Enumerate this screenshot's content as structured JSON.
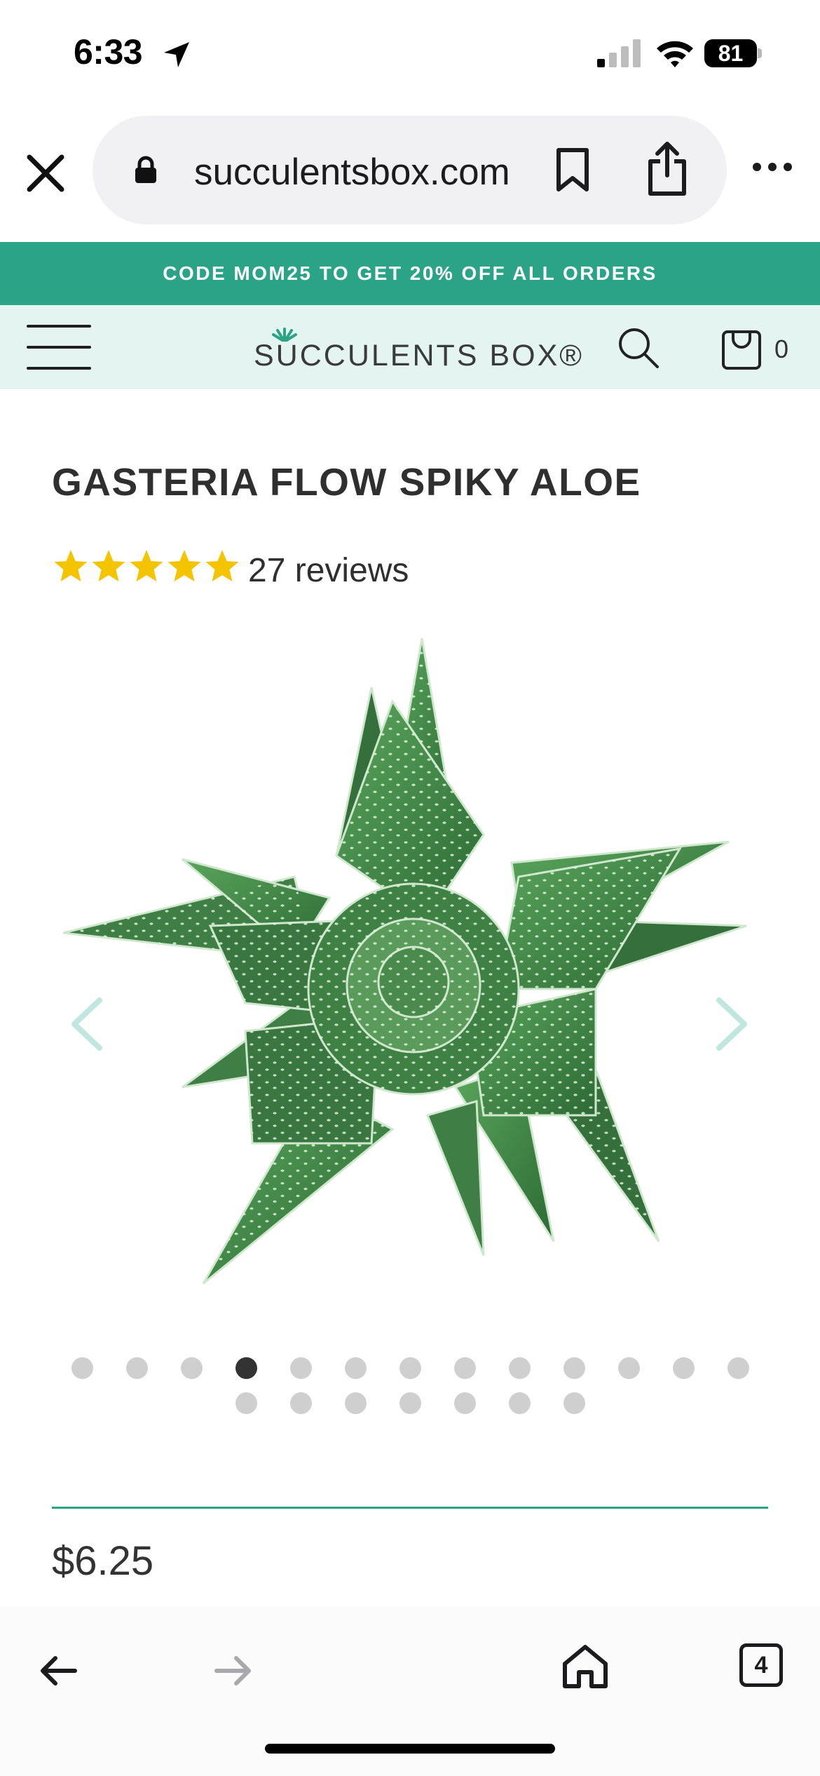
{
  "status_bar": {
    "time": "6:33",
    "battery": "81"
  },
  "browser": {
    "url": "succulentsbox.com",
    "open_tabs": "4"
  },
  "promo": {
    "text": "CODE MOM25 TO GET 20% OFF ALL ORDERS"
  },
  "header": {
    "logo_text": "SUCCULENTS BOX®",
    "cart_count": "0"
  },
  "product": {
    "title": "GASTERIA FLOW SPIKY ALOE",
    "rating_stars": 5,
    "reviews": "27 reviews",
    "price": "$6.25",
    "image_subject": "gasteria-spiky-aloe-photo"
  },
  "gallery": {
    "total_images": 20,
    "active_index": 3
  },
  "colors": {
    "accent": "#2ba386",
    "header_bg": "#e4f4f1",
    "star": "#f5c400",
    "arrow": "#bfe7df"
  }
}
